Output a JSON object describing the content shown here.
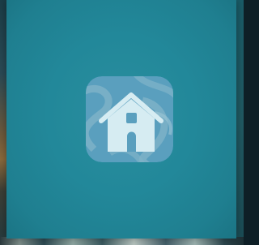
{
  "app": {
    "icon_name": "home-icon",
    "colors": {
      "splash_background": "#22889a",
      "icon_tile": "#5a9fbe",
      "icon_swirl": "#7fb3c8",
      "house_fill": "#d6ecf2"
    }
  }
}
